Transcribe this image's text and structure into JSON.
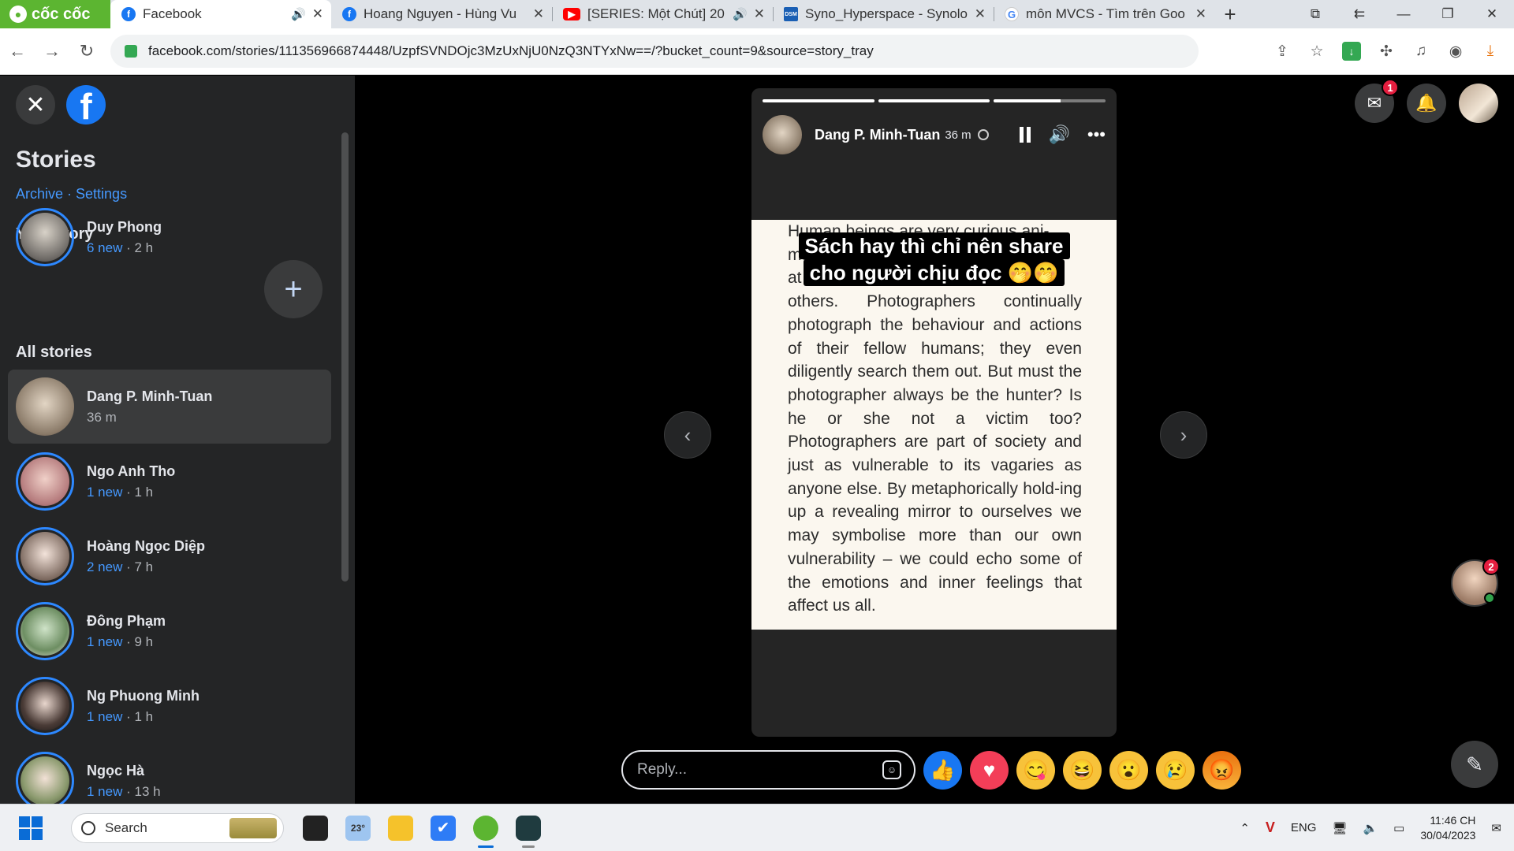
{
  "browser": {
    "brand": "cốc cốc",
    "tabs": [
      {
        "title": "Facebook",
        "favicon": "facebook-icon",
        "audio": true,
        "active": true
      },
      {
        "title": "Hoang Nguyen - Hùng Vu",
        "favicon": "facebook-icon",
        "audio": false,
        "active": false
      },
      {
        "title": "[SERIES: Một Chút] 20",
        "favicon": "youtube-icon",
        "audio": true,
        "active": false
      },
      {
        "title": "Syno_Hyperspace - Synolo",
        "favicon": "dsm-icon",
        "audio": false,
        "active": false
      },
      {
        "title": "môn MVCS - Tìm trên Goo",
        "favicon": "google-icon",
        "audio": false,
        "active": false
      }
    ],
    "dsm_label": "DSM",
    "google_label": "G",
    "url": "facebook.com/stories/111356966874448/UzpfSVNDOjc3MzUxNjU0NzQ3NTYxNw==/?bucket_count=9&source=story_tray"
  },
  "sidebar": {
    "title": "Stories",
    "links": [
      "Archive",
      "Settings"
    ],
    "link_separator": " · ",
    "your_story_heading": "Your story",
    "your_story": {
      "name": "Duy Phong",
      "new": "6 new",
      "time": "2 h"
    },
    "all_stories_heading": "All stories",
    "stories": [
      {
        "name": "Dang P. Minh-Tuan",
        "new": "",
        "time": "36 m",
        "selected": true
      },
      {
        "name": "Ngo Anh Tho",
        "new": "1 new",
        "time": "1 h",
        "selected": false
      },
      {
        "name": "Hoàng Ngọc Diệp",
        "new": "2 new",
        "time": "7 h",
        "selected": false
      },
      {
        "name": "Đông Phạm",
        "new": "1 new",
        "time": "9 h",
        "selected": false
      },
      {
        "name": "Ng Phuong Minh",
        "new": "1 new",
        "time": "1 h",
        "selected": false
      },
      {
        "name": "Ngọc Hà",
        "new": "1 new",
        "time": "13 h",
        "selected": false
      }
    ],
    "meta_separator": " · "
  },
  "story": {
    "author": "Dang P. Minh-Tuan",
    "time": "36 m",
    "progress": [
      1.0,
      1.0,
      0.6
    ],
    "caption_lines": [
      "Sách hay thì chỉ nên share",
      "cho người chịu đọc 🤭🤭"
    ],
    "book_text": "Human beings are very curious ani-\nmals, always looking intently\nat the lives and actions of\nothers. Photographers continually photograph the behaviour and actions of their fellow humans; they even diligently search them out. But must the photographer always be the hunter? Is he or she not a victim too? Photographers are part of society and just as vulnerable to its vagaries as anyone else. By metaphorically hold-ing up a revealing mirror to ourselves we may symbolise more than our own vulnerability – we could echo some of the emotions and inner feelings that affect us all.",
    "reply_placeholder": "Reply...",
    "reactions": [
      "like",
      "love",
      "yum",
      "haha",
      "wow",
      "sad",
      "angry"
    ]
  },
  "notifications": {
    "messenger_badge": "1",
    "chat_badge": "2"
  },
  "taskbar": {
    "search_label": "Search",
    "weather": "23°",
    "lang": "ENG",
    "time": "11:46 CH",
    "date": "30/04/2023"
  },
  "colors": {
    "fb_blue": "#1877f2",
    "story_ring": "#2d88ff",
    "sidebar_bg": "#242526",
    "coccoc_green": "#5cb531"
  }
}
